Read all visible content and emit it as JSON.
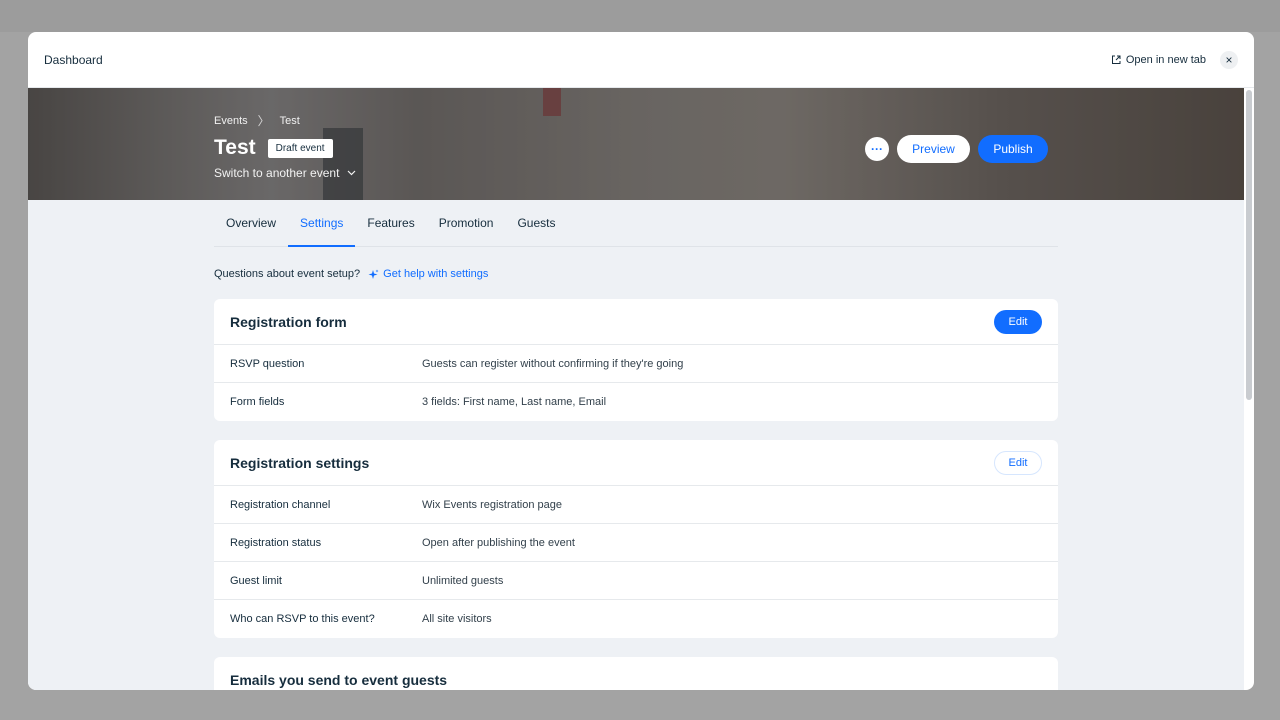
{
  "modal": {
    "title": "Dashboard",
    "open_new_tab": "Open in new tab",
    "close_symbol": "×"
  },
  "hero": {
    "breadcrumb": [
      "Events",
      "Test"
    ],
    "breadcrumb_separator": "〉",
    "event_title": "Test",
    "status_badge": "Draft event",
    "switch_label": "Switch to another event",
    "more_symbol": "···",
    "preview_label": "Preview",
    "publish_label": "Publish"
  },
  "tabs": [
    {
      "label": "Overview",
      "active": false
    },
    {
      "label": "Settings",
      "active": true
    },
    {
      "label": "Features",
      "active": false
    },
    {
      "label": "Promotion",
      "active": false
    },
    {
      "label": "Guests",
      "active": false
    }
  ],
  "help": {
    "question": "Questions about event setup?",
    "link": "Get help with settings"
  },
  "cards": [
    {
      "title": "Registration form",
      "edit_label": "Edit",
      "rows": [
        {
          "label": "RSVP question",
          "value": "Guests can register without confirming if they're going"
        },
        {
          "label": "Form fields",
          "value": "3 fields: First name, Last name, Email"
        }
      ]
    },
    {
      "title": "Registration settings",
      "edit_label": "Edit",
      "rows": [
        {
          "label": "Registration channel",
          "value": "Wix Events registration page"
        },
        {
          "label": "Registration status",
          "value": "Open after publishing the event"
        },
        {
          "label": "Guest limit",
          "value": "Unlimited guests"
        },
        {
          "label": "Who can RSVP to this event?",
          "value": "All site visitors"
        }
      ]
    },
    {
      "title": "Emails you send to event guests"
    }
  ],
  "colors": {
    "accent": "#116dff",
    "text": "#162d3d",
    "page_bg": "#eef1f5"
  }
}
